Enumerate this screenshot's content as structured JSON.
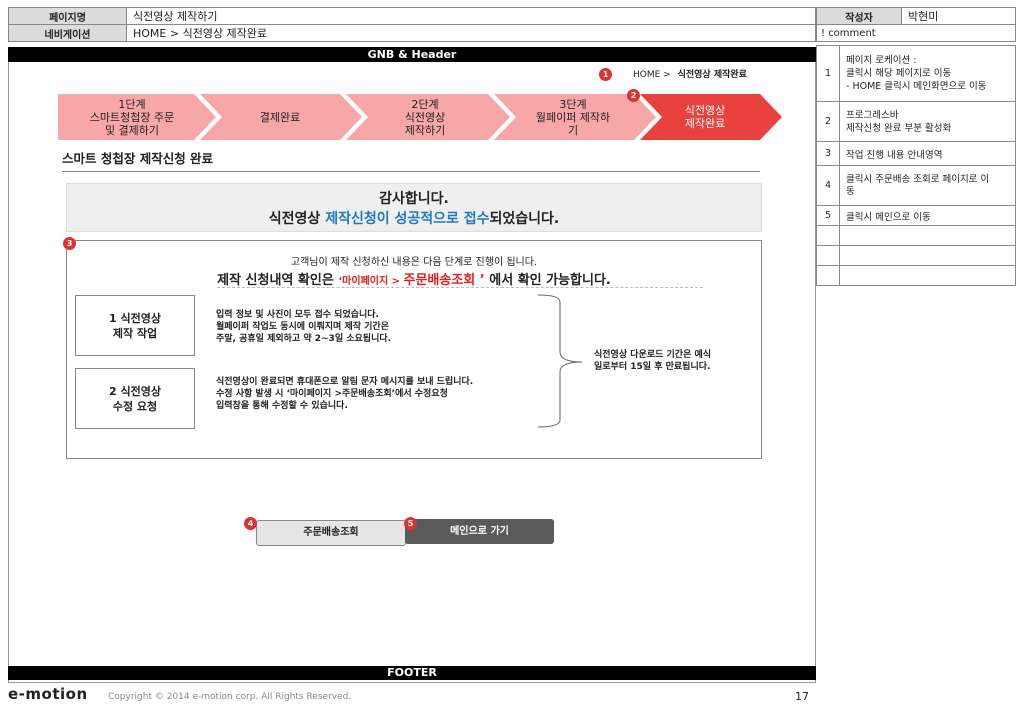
{
  "meta": {
    "page_name_label": "페이지명",
    "page_name": "식전영상 제작하기",
    "nav_label": "네비게이션",
    "nav_path": "HOME > 식전영상 제작완료",
    "author_label": "작성자",
    "author": "박현미"
  },
  "header": {
    "gnb": "GNB & Header"
  },
  "breadcrumb": {
    "home": "HOME >",
    "current": "식전영상 제작완료"
  },
  "steps": [
    {
      "lines": [
        "1단계",
        "스마트청첩장 주문",
        "및 결제하기"
      ]
    },
    {
      "lines": [
        "결제완료"
      ]
    },
    {
      "lines": [
        "2단계",
        "식전영상",
        "제작하기"
      ]
    },
    {
      "lines": [
        "3단계",
        "월페이퍼 제작하",
        "기"
      ]
    },
    {
      "lines": [
        "식전영상",
        "제작완료"
      ]
    }
  ],
  "section_title": "스마트 청첩장 제작신청 완료",
  "thanks": {
    "line1": "감사합니다.",
    "line2_pre": "식전영상 ",
    "line2_em": "제작신청이 성공적으로 접수",
    "line2_post": "되었습니다."
  },
  "info": {
    "intro": "고객님이 제작 신청하신 내용은 다음 단계로 진행이 됩니다.",
    "confirm_pre": "제작 신청내역 확인은 ",
    "confirm_q1": "‘",
    "confirm_em1": "마이페이지 > ",
    "confirm_em2": "주문배송조회",
    "confirm_q2": " ’",
    "confirm_post": " 에서 확인 가능합니다.",
    "item1_title_num": "1",
    "item1_title_a": "식전영상",
    "item1_title_b": "제작 작업",
    "item1_desc": [
      "입력 정보 및 사진이 모두 접수 되었습니다.",
      "월페이퍼 작업도 동시에 이뤄지며 제작 기간은",
      "주말, 공휴일 제외하고 약 2~3일 소요됩니다."
    ],
    "item2_title_num": "2",
    "item2_title_a": "식전영상",
    "item2_title_b": "수정 요청",
    "item2_desc": [
      "식전영상이 완료되면 휴대폰으로 알림 문자 메시지를 보내 드립니다.",
      "수정 사항 발생 시 ‘마이페이지 >주문배송조회’에서 수정요청",
      "입력창을 통해 수정할 수 있습니다."
    ],
    "side_note": [
      "식전영상 다운로드 기간은 예식",
      "일로부터 15일 후 만료됩니다."
    ]
  },
  "buttons": {
    "order": "주문배송조회",
    "main": "메인으로 가기"
  },
  "footer": {
    "label": "FOOTER",
    "logo": "e-motion",
    "copyright": "Copyright © 2014 e-motion corp. All Rights Reserved.",
    "page_number": "17"
  },
  "comments": {
    "header": "! comment",
    "rows": [
      {
        "num": "1",
        "lines": [
          "페이지 로케이션 :",
          "클릭시 해당 페이지로 이동",
          "- HOME 클릭시 메인화면으로 이동"
        ]
      },
      {
        "num": "2",
        "lines": [
          "프로그레스바",
          "제작신청 완료 부분 활성화"
        ]
      },
      {
        "num": "3",
        "lines": [
          "작업 진행 내용 안내영역"
        ]
      },
      {
        "num": "4",
        "lines": [
          "클릭시 주문배송 조회로 페이지로 이",
          "동"
        ]
      },
      {
        "num": "5",
        "lines": [
          " 클릭시 메인으로 이동"
        ]
      }
    ]
  },
  "markers": [
    "1",
    "2",
    "3",
    "4",
    "5"
  ],
  "colors": {
    "step_inactive": "#f7a7a7",
    "step_active": "#e8413e",
    "accent_blue": "#1f7ac2",
    "accent_red": "#e0201c",
    "header_bg": "#000000"
  }
}
